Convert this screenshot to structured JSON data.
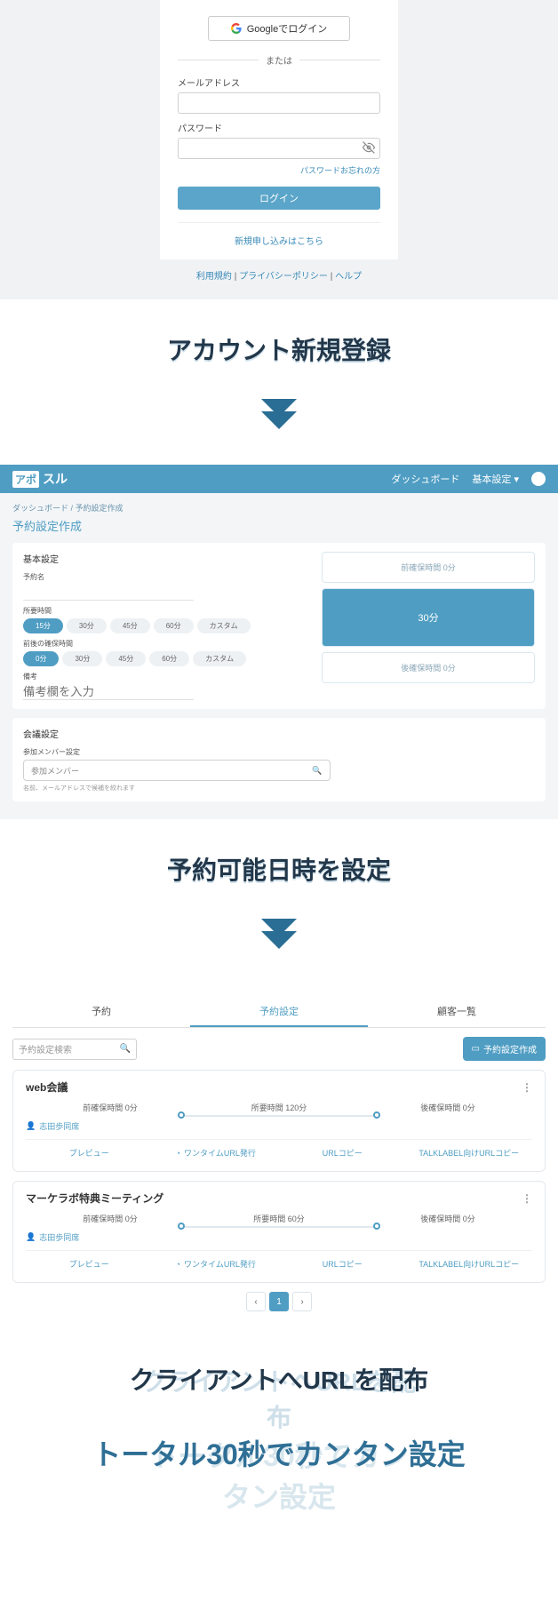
{
  "login": {
    "google_btn": "Googleでログイン",
    "or": "または",
    "email_label": "メールアドレス",
    "password_label": "パスワード",
    "forgot": "パスワードお忘れの方",
    "login_btn": "ログイン",
    "signup": "新規申し込みはこちら",
    "terms": "利用規約",
    "privacy": "プライバシーポリシー",
    "help": "ヘルプ"
  },
  "captions": {
    "c1": "アカウント新規登録",
    "c2": "予約可能日時を設定",
    "c3": "クライアントへURLを配布",
    "final": "トータル30秒でカンタン設定"
  },
  "app": {
    "logo": "アポスル",
    "nav_dashboard": "ダッシュボード",
    "nav_settings": "基本設定",
    "crumb_dash": "ダッシュボード",
    "crumb_here": "予約設定作成",
    "page_title": "予約設定作成",
    "sec_basic": "基本設定",
    "lbl_name": "予約名",
    "lbl_duration": "所要時間",
    "durations": [
      "15分",
      "30分",
      "45分",
      "60分",
      "カスタム"
    ],
    "lbl_buffer": "前後の確保時間",
    "buffers": [
      "0分",
      "30分",
      "45分",
      "60分",
      "カスタム"
    ],
    "lbl_memo": "備考",
    "memo_ph": "備考欄を入力",
    "time_before": "前確保時間  0分",
    "time_main": "30分",
    "time_after": "後確保時間  0分",
    "sec_meeting": "会議設定",
    "lbl_members": "参加メンバー設定",
    "member_ph": "参加メンバー",
    "member_hint": "名前、メールアドレスで候補を絞れます"
  },
  "tabs": {
    "t1": "予約",
    "t2": "予約設定",
    "t3": "顧客一覧",
    "search_ph": "予約設定検索",
    "create": "予約設定作成",
    "rows": [
      {
        "title": "web会議",
        "before": "前確保時間  0分",
        "dur": "所要時間  120分",
        "after": "後確保時間  0分",
        "owner": "志田歩同席"
      },
      {
        "title": "マーケラボ特典ミーティング",
        "before": "前確保時間  0分",
        "dur": "所要時間  60分",
        "after": "後確保時間  0分",
        "owner": "志田歩同席"
      }
    ],
    "act_preview": "プレビュー",
    "act_onetime": "ワンタイムURL発行",
    "act_copy": "URLコピー",
    "act_talk": "TALKLABEL向けURLコピー",
    "page": "1"
  }
}
